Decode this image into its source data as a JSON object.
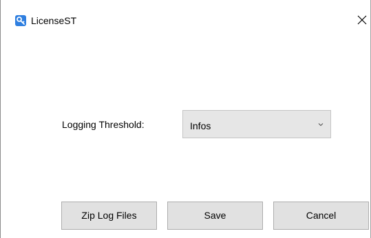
{
  "window": {
    "title": "LicenseST",
    "app_icon": "key-icon",
    "close_icon": "close-icon"
  },
  "form": {
    "threshold_label": "Logging Threshold:",
    "threshold_value": "Infos",
    "dropdown_icon": "chevron-down-icon"
  },
  "actions": {
    "zip_label": "Zip Log Files",
    "save_label": "Save",
    "cancel_label": "Cancel"
  },
  "colors": {
    "app_icon_bg": "#2f7fe0",
    "button_bg": "#e1e1e1",
    "select_bg": "#e6e6e6"
  }
}
